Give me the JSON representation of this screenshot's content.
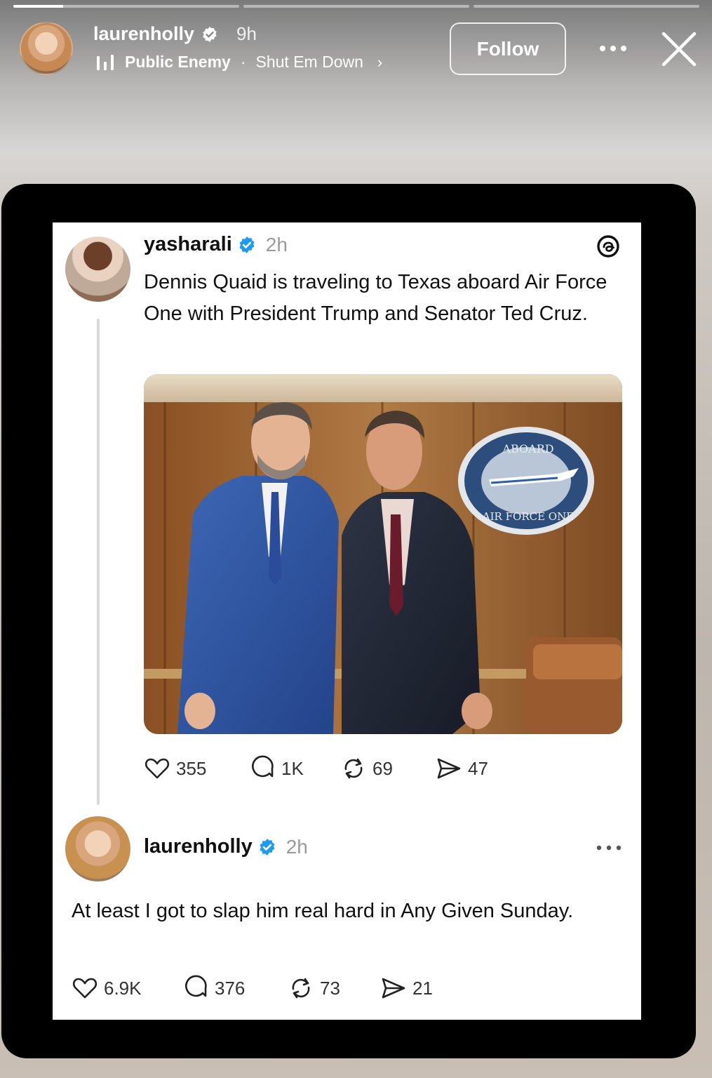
{
  "story": {
    "progress": [
      1.0,
      0.0,
      0.0
    ],
    "progress_partial": 0.22,
    "username": "laurenholly",
    "time": "9h",
    "music_artist": "Public Enemy",
    "music_sep": "·",
    "music_track": "Shut Em Down",
    "music_chevron": "›",
    "follow_label": "Follow"
  },
  "post1": {
    "username": "yasharali",
    "time": "2h",
    "text": "Dennis Quaid is traveling to Texas aboard Air Force One with President Trump and Senator Ted Cruz.",
    "photo_seal_top": "ABOARD",
    "photo_seal_bottom": "AIR FORCE ONE",
    "likes": "355",
    "replies": "1K",
    "reposts": "69",
    "shares": "47"
  },
  "post2": {
    "username": "laurenholly",
    "time": "2h",
    "text": "At least I got to slap him real hard in Any Given Sunday.",
    "likes": "6.9K",
    "replies": "376",
    "reposts": "73",
    "shares": "21"
  },
  "colors": {
    "verified": "#1d9bf0",
    "frame": "#000000",
    "card": "#ffffff"
  },
  "icons": [
    "verified-icon",
    "music-bars-icon",
    "more-icon",
    "close-icon",
    "threads-logo-icon",
    "heart-icon",
    "comment-icon",
    "repost-icon",
    "share-icon"
  ]
}
